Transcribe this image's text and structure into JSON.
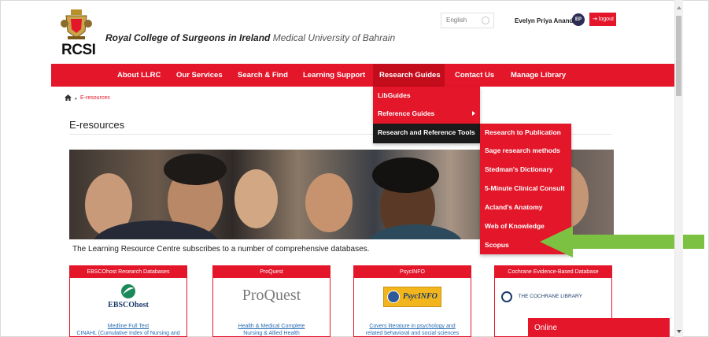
{
  "header": {
    "logo_text": "RCSI",
    "college_name": "Royal College of Surgeons in Ireland",
    "university_name": "Medical University of Bahrain",
    "language": "English",
    "user_name": "Evelyn Priya Anand",
    "avatar_initials": "EP",
    "logout_label": "logout"
  },
  "nav": {
    "items": [
      {
        "label": "About LLRC"
      },
      {
        "label": "Our Services"
      },
      {
        "label": "Search & Find"
      },
      {
        "label": "Learning Support"
      },
      {
        "label": "Research Guides"
      },
      {
        "label": "Contact Us"
      },
      {
        "label": "Manage Library"
      }
    ]
  },
  "dropdown_research_guides": {
    "items": [
      {
        "label": "LibGuides"
      },
      {
        "label": "Reference Guides"
      },
      {
        "label": "Research and Reference Tools"
      }
    ]
  },
  "dropdown_tools": {
    "items": [
      {
        "label": "Research to Publication"
      },
      {
        "label": "Sage research methods"
      },
      {
        "label": "Stedman's Dictionary"
      },
      {
        "label": "5-Minute Clinical Consult"
      },
      {
        "label": "Acland's Anatomy"
      },
      {
        "label": "Web of Knowledge"
      },
      {
        "label": "Scopus"
      }
    ]
  },
  "breadcrumb": {
    "current": "E-resources"
  },
  "page": {
    "title": "E-resources",
    "intro": "The Learning Resource Centre subscribes to a number of comprehensive databases."
  },
  "cards": [
    {
      "title": "EBSCOhost Research Databases",
      "logo": "EBSCOhost",
      "link": "Medline Full Text",
      "desc": "CINAHL (Cumulative Index of Nursing and"
    },
    {
      "title": "ProQuest",
      "logo": "ProQuest",
      "link": "Health & Medical Complete",
      "desc": "Nursing & Allied Health"
    },
    {
      "title": "PsycINFO",
      "logo": "PsycINFO",
      "link": "Covers literature in psychology and",
      "desc": "related behavioral and social sciences"
    },
    {
      "title": "Cochrane Evidence-Based Database",
      "logo": "THE COCHRANE LIBRARY",
      "link": "",
      "desc": ""
    }
  ],
  "chat": {
    "label": "Online"
  },
  "colors": {
    "brand_red": "#e3162a",
    "active_dark": "#1a1a1a",
    "arrow_green": "#7dc142"
  }
}
